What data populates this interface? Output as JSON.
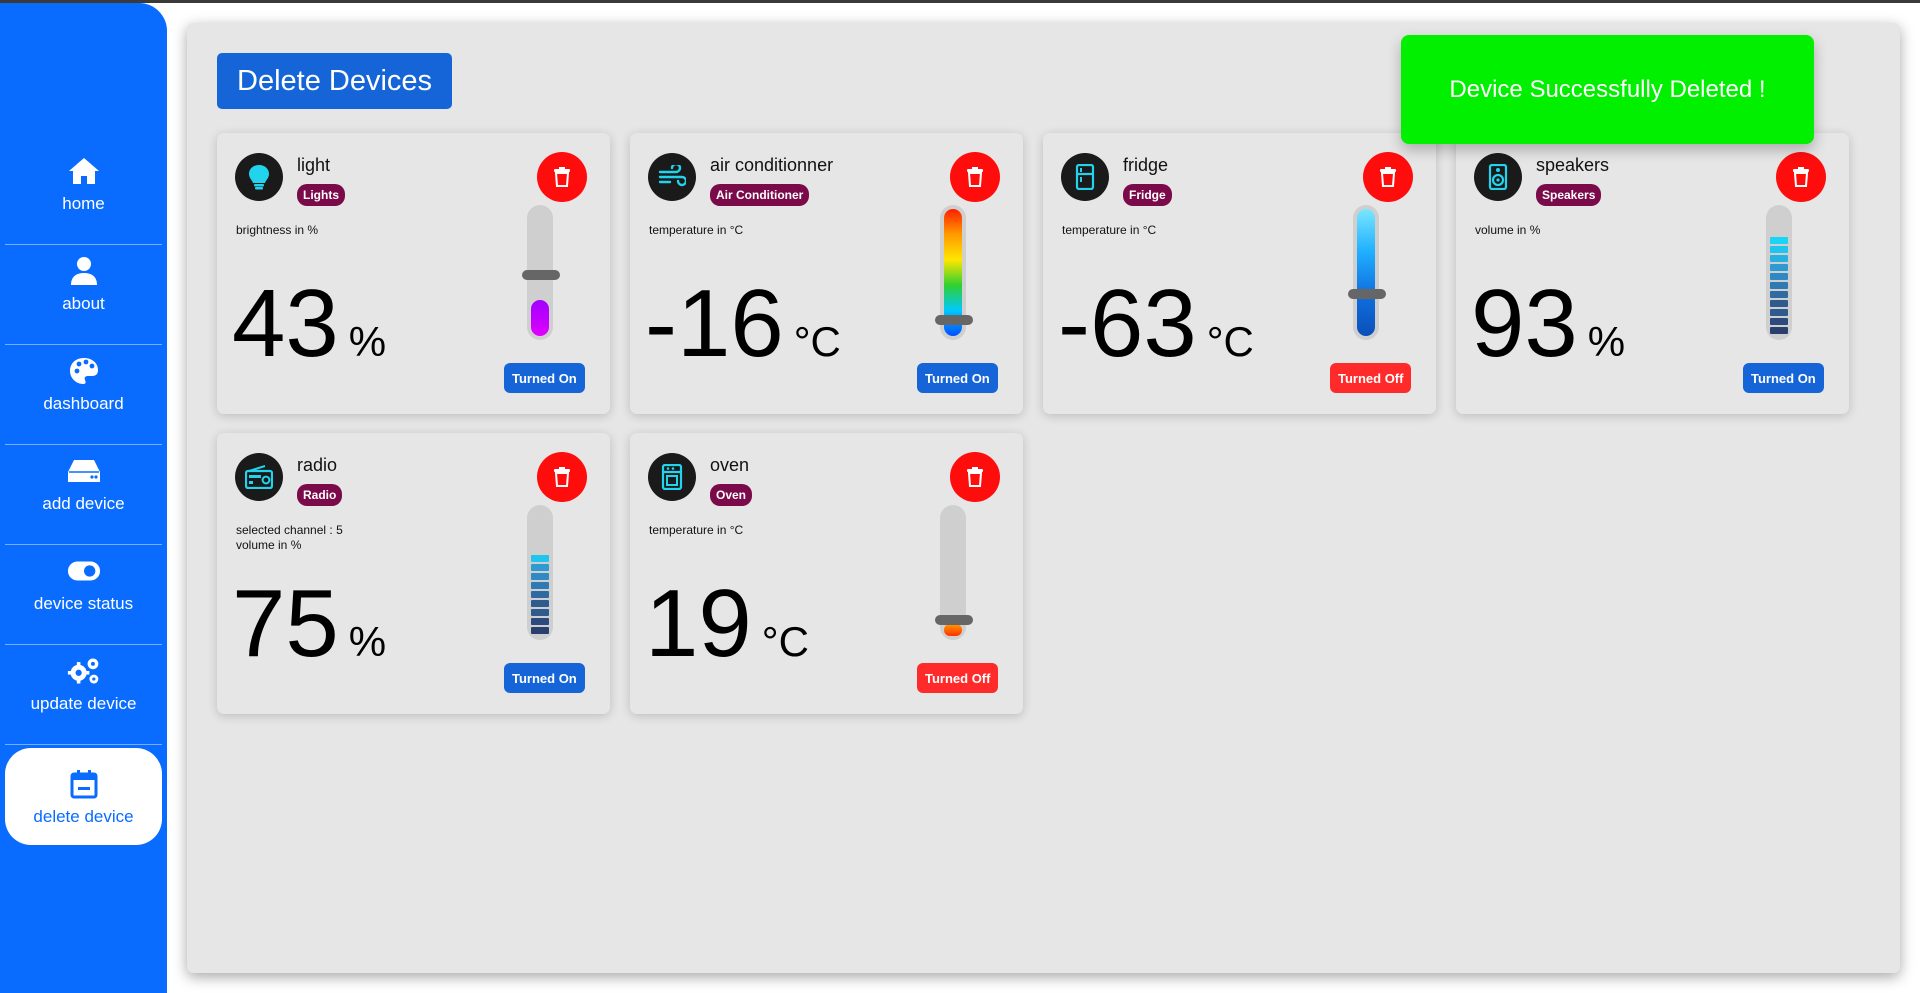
{
  "sidebar": {
    "items": [
      {
        "label": "home",
        "icon": "home-icon"
      },
      {
        "label": "about",
        "icon": "user-icon"
      },
      {
        "label": "dashboard",
        "icon": "palette-icon"
      },
      {
        "label": "add device",
        "icon": "hdd-icon"
      },
      {
        "label": "device status",
        "icon": "toggle-icon"
      },
      {
        "label": "update device",
        "icon": "gears-icon"
      },
      {
        "label": "delete device",
        "icon": "calendar-minus-icon",
        "active": true
      }
    ]
  },
  "page": {
    "title": "Delete Devices",
    "toast": "Device Successfully Deleted !"
  },
  "colors": {
    "sidebar": "#0a6cff",
    "primary_button": "#1565d8",
    "delete_button": "#ff0d0d",
    "toast": "#00f000",
    "badge": "#7a0a4a",
    "turned_off": "#ff2b2b"
  },
  "devices": [
    {
      "name": "light",
      "badge": "Lights",
      "hint": "brightness in %",
      "hint2": "",
      "value": "43",
      "unit": "%",
      "status": "Turned On",
      "level_percent": 43,
      "icon": "lightbulb-icon"
    },
    {
      "name": "air conditionner",
      "badge": "Air Conditioner",
      "hint": "temperature in °C",
      "hint2": "",
      "value": "-16",
      "unit": "°C",
      "status": "Turned On",
      "level_percent": 12,
      "icon": "wind-icon"
    },
    {
      "name": "fridge",
      "badge": "Fridge",
      "hint": "temperature in °C",
      "hint2": "",
      "value": "-63",
      "unit": "°C",
      "status": "Turned Off",
      "level_percent": 30,
      "icon": "fridge-icon"
    },
    {
      "name": "speakers",
      "badge": "Speakers",
      "hint": "volume in %",
      "hint2": "",
      "value": "93",
      "unit": "%",
      "status": "Turned On",
      "level_percent": 93,
      "icon": "speaker-icon"
    },
    {
      "name": "radio",
      "badge": "Radio",
      "hint": "selected channel : 5",
      "hint2": "volume in %",
      "value": "75",
      "unit": "%",
      "status": "Turned On",
      "level_percent": 75,
      "icon": "radio-icon"
    },
    {
      "name": "oven",
      "badge": "Oven",
      "hint": "temperature in °C",
      "hint2": "",
      "value": "19",
      "unit": "°C",
      "status": "Turned Off",
      "level_percent": 8,
      "icon": "oven-icon"
    }
  ]
}
